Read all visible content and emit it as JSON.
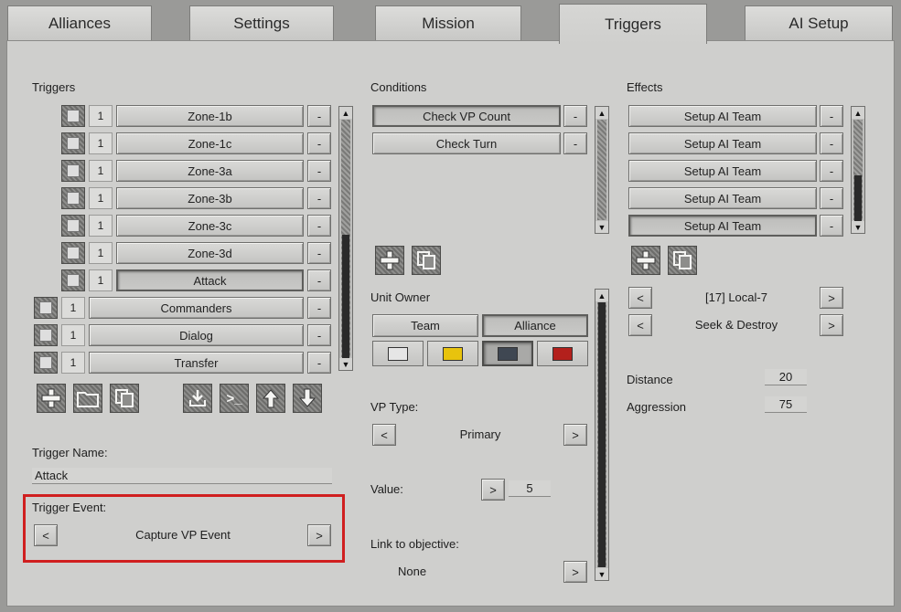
{
  "tabs": [
    {
      "label": "Alliances",
      "active": false
    },
    {
      "label": "Settings",
      "active": false
    },
    {
      "label": "Mission",
      "active": false
    },
    {
      "label": "Triggers",
      "active": true
    },
    {
      "label": "AI Setup",
      "active": false
    }
  ],
  "triggers": {
    "heading": "Triggers",
    "items": [
      {
        "num": "1",
        "name": "Zone-1b",
        "remove": "-"
      },
      {
        "num": "1",
        "name": "Zone-1c",
        "remove": "-"
      },
      {
        "num": "1",
        "name": "Zone-3a",
        "remove": "-"
      },
      {
        "num": "1",
        "name": "Zone-3b",
        "remove": "-"
      },
      {
        "num": "1",
        "name": "Zone-3c",
        "remove": "-"
      },
      {
        "num": "1",
        "name": "Zone-3d",
        "remove": "-"
      },
      {
        "num": "1",
        "name": "Attack",
        "remove": "-",
        "selected": true
      },
      {
        "num": "1",
        "name": "Commanders",
        "remove": "-"
      },
      {
        "num": "1",
        "name": "Dialog",
        "remove": "-"
      },
      {
        "num": "1",
        "name": "Transfer",
        "remove": "-"
      }
    ],
    "tools": [
      "plus-icon",
      "folder-icon",
      "copy-icon",
      "import-icon",
      "console-icon",
      "arrow-up-icon",
      "arrow-down-icon"
    ],
    "console_glyph": ">_",
    "name_label": "Trigger Name:",
    "name_value": "Attack",
    "event_label": "Trigger Event:",
    "event_value": "Capture VP Event",
    "prev": "<",
    "next": ">"
  },
  "conditions": {
    "heading": "Conditions",
    "items": [
      {
        "name": "Check VP Count",
        "remove": "-",
        "selected": true
      },
      {
        "name": "Check Turn",
        "remove": "-"
      }
    ],
    "unit_owner_label": "Unit Owner",
    "team_label": "Team",
    "alliance_label": "Alliance",
    "colors": [
      "#e6e6e6",
      "#e8c30d",
      "#3f4752",
      "#b3201c"
    ],
    "selected_color_index": 2,
    "vp_type_label": "VP Type:",
    "vp_type_value": "Primary",
    "value_label": "Value:",
    "value_value": "5",
    "link_label": "Link to objective:",
    "link_value": "None",
    "prev": "<",
    "next": ">"
  },
  "effects": {
    "heading": "Effects",
    "items": [
      {
        "name": "Setup AI Team",
        "remove": "-"
      },
      {
        "name": "Setup AI Team",
        "remove": "-"
      },
      {
        "name": "Setup AI Team",
        "remove": "-"
      },
      {
        "name": "Setup AI Team",
        "remove": "-"
      },
      {
        "name": "Setup AI Team",
        "remove": "-",
        "selected": true
      }
    ],
    "zone_value": "[17] Local-7",
    "order_value": "Seek & Destroy",
    "distance_label": "Distance",
    "distance_value": "20",
    "aggression_label": "Aggression",
    "aggression_value": "75",
    "prev": "<",
    "next": ">"
  },
  "colors": {
    "highlight": "#d01f1f",
    "panel": "#cfcfcd"
  }
}
